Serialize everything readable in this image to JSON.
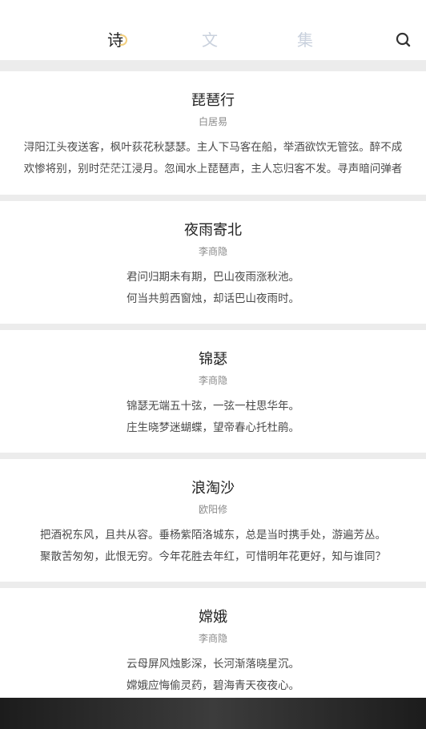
{
  "tabs": [
    {
      "label": "诗",
      "active": true
    },
    {
      "label": "文",
      "active": false
    },
    {
      "label": "集",
      "active": false
    }
  ],
  "poems": [
    {
      "title": "琵琶行",
      "author": "白居易",
      "lines": [
        "浔阳江头夜送客，枫叶荻花秋瑟瑟。主人下马客在船，举酒欲饮无管弦。醉不成",
        "欢惨将别，别时茫茫江浸月。忽闻水上琵琶声，主人忘归客不发。寻声暗问弹者"
      ]
    },
    {
      "title": "夜雨寄北",
      "author": "李商隐",
      "lines": [
        "君问归期未有期，巴山夜雨涨秋池。",
        "何当共剪西窗烛，却话巴山夜雨时。"
      ]
    },
    {
      "title": "锦瑟",
      "author": "李商隐",
      "lines": [
        "锦瑟无端五十弦，一弦一柱思华年。",
        "庄生晓梦迷蝴蝶，望帝春心托杜鹃。"
      ]
    },
    {
      "title": "浪淘沙",
      "author": "欧阳修",
      "lines": [
        "把酒祝东风，且共从容。垂杨紫陌洛城东，总是当时携手处，游遍芳丛。",
        "聚散苦匆匆，此恨无穷。今年花胜去年红，可惜明年花更好，知与谁同？"
      ]
    },
    {
      "title": "嫦娥",
      "author": "李商隐",
      "lines": [
        "云母屏风烛影深，长河渐落晓星沉。",
        "嫦娥应悔偷灵药，碧海青天夜夜心。"
      ]
    }
  ]
}
